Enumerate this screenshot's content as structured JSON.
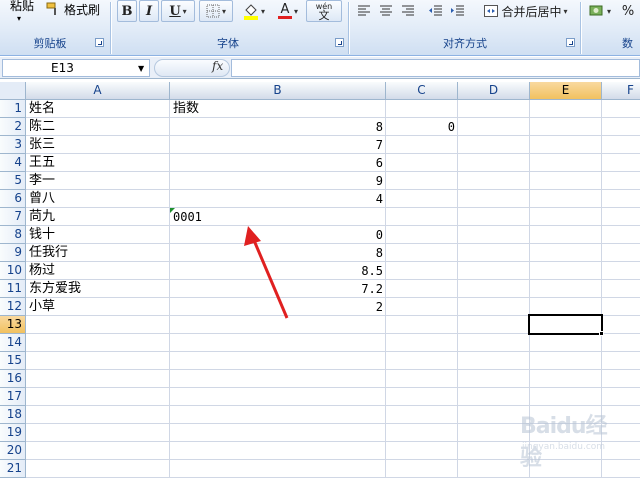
{
  "ribbon": {
    "clipboard": {
      "paste_label": "粘贴",
      "format_painter_label": "格式刷",
      "group_label": "剪贴板"
    },
    "font": {
      "bold": "B",
      "italic": "I",
      "underline": "U",
      "font_color_letter": "A",
      "phonetic_label": "wén",
      "phonetic_glyph": "文",
      "group_label": "字体",
      "fill_color": "#ffff00",
      "font_color": "#e02020"
    },
    "alignment": {
      "merge_center_label": "合并后居中",
      "group_label": "对齐方式"
    },
    "number": {
      "percent": "%",
      "group_label": "数"
    }
  },
  "formula_bar": {
    "name_box": "E13",
    "fx": "fx",
    "formula": ""
  },
  "grid": {
    "columns": [
      "A",
      "B",
      "C",
      "D",
      "E",
      "F"
    ],
    "selected_column": "E",
    "rows": [
      "1",
      "2",
      "3",
      "4",
      "5",
      "6",
      "7",
      "8",
      "9",
      "10",
      "11",
      "12",
      "13",
      "14",
      "15",
      "16",
      "17",
      "18",
      "19",
      "20",
      "21"
    ],
    "selected_row": "13",
    "col_a": [
      "姓名",
      "陈二",
      "张三",
      "王五",
      "李一",
      "曾八",
      "苘九",
      "钱十",
      "任我行",
      "杨过",
      "东方爱我",
      "小草"
    ],
    "b1": "指数",
    "col_b": [
      "8",
      "7",
      "6",
      "9",
      "4",
      "",
      "0",
      "8",
      "8.5",
      "7.2",
      "2"
    ],
    "b7_text": "0001",
    "c2": "0",
    "active_cell": "E13"
  },
  "watermark": {
    "logo": "Baidu经验",
    "url": "jingyan.baidu.com"
  },
  "colors": {
    "accent_border": "#8db2e3",
    "selected_header": "#f1c15f",
    "arrow": "#e02020",
    "error_triangle": "#1e8f2e"
  }
}
